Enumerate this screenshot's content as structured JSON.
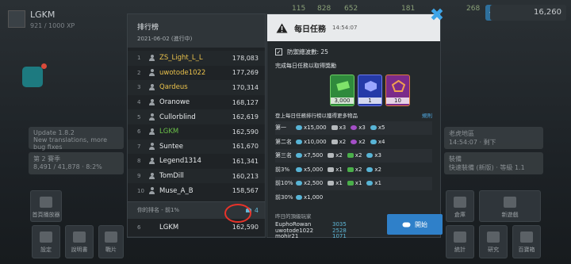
{
  "background": {
    "username": "LGKM",
    "xp": "921 / 1000 XP",
    "resources": [
      "115",
      "828",
      "652",
      "181",
      "268"
    ],
    "cash": "16,260",
    "cards": [
      {
        "title": "Update 1.8.2",
        "subtitle": "New translations, more bug fixes"
      },
      {
        "title": "第 2 賽季",
        "subtitle": "8,491 / 41,878 · 8:2%"
      },
      {
        "title": "老虎地區",
        "subtitle": "14:54:07 · 剩下"
      },
      {
        "title": "裝備",
        "subtitle": "快速裝備 (新版) · 等級 1.1"
      }
    ],
    "buttons": [
      "首頁播放器",
      "設定",
      "說明書",
      "戰片",
      "倉庫",
      "新遊戲",
      "統計",
      "研究",
      "百寶箱"
    ]
  },
  "leaderboard": {
    "title": "排行榜",
    "subtitle": "2021-06-02 (進行中)",
    "rows": [
      {
        "rank": "1",
        "name": "ZS_Light_L_L",
        "score": "178,083",
        "color": "#e9c14b"
      },
      {
        "rank": "2",
        "name": "uwotode1022",
        "score": "177,269",
        "color": "#e9c14b"
      },
      {
        "rank": "3",
        "name": "Qardeus",
        "score": "170,314",
        "color": "#e9c14b"
      },
      {
        "rank": "4",
        "name": "Oranowe",
        "score": "168,127",
        "color": "#e8ebed"
      },
      {
        "rank": "5",
        "name": "Cullorblind",
        "score": "162,619",
        "color": "#e8ebed"
      },
      {
        "rank": "6",
        "name": "LGKM",
        "score": "162,590",
        "color": "#6cc24a"
      },
      {
        "rank": "7",
        "name": "Suntee",
        "score": "161,670",
        "color": "#e8ebed"
      },
      {
        "rank": "8",
        "name": "Legend1314",
        "score": "161,341",
        "color": "#e8ebed"
      },
      {
        "rank": "9",
        "name": "TomDill",
        "score": "160,213",
        "color": "#e8ebed"
      },
      {
        "rank": "10",
        "name": "Muse_A_B",
        "score": "158,567",
        "color": "#e8ebed"
      }
    ],
    "my_rank_label": "你的排名 - 前1%",
    "my_tokens": "4",
    "me": {
      "rank": "6",
      "name": "LGKM",
      "score": "162,590"
    }
  },
  "daily": {
    "title": "每日任務",
    "time": "14:54:07",
    "task": "防禦總波數: 25",
    "complete_label": "完成每日任務以取得獎勵",
    "rewards": [
      {
        "value": "3,000",
        "kind": "green"
      },
      {
        "value": "1",
        "kind": "blue"
      },
      {
        "value": "10",
        "kind": "purple"
      }
    ],
    "rank_label": "登上每日任務排行榜以獲得更多物品",
    "rules": "規則",
    "tiers": [
      {
        "tier": "第一",
        "items": [
          {
            "icon": "tok",
            "v": "x15,000"
          },
          {
            "icon": "gun",
            "v": "x3"
          },
          {
            "icon": "pur",
            "v": "x3"
          },
          {
            "icon": "tok",
            "v": "x5"
          }
        ]
      },
      {
        "tier": "第二名",
        "items": [
          {
            "icon": "tok",
            "v": "x10,000"
          },
          {
            "icon": "gun",
            "v": "x2"
          },
          {
            "icon": "pur",
            "v": "x2"
          },
          {
            "icon": "tok",
            "v": "x4"
          }
        ]
      },
      {
        "tier": "第三名",
        "items": [
          {
            "icon": "tok",
            "v": "x7,500"
          },
          {
            "icon": "gun",
            "v": "x2"
          },
          {
            "icon": "grn",
            "v": "x2"
          },
          {
            "icon": "tok",
            "v": "x3"
          }
        ]
      },
      {
        "tier": "前3%",
        "items": [
          {
            "icon": "tok",
            "v": "x5,000"
          },
          {
            "icon": "gun",
            "v": "x1"
          },
          {
            "icon": "grn",
            "v": "x2"
          },
          {
            "icon": "tok",
            "v": "x2"
          }
        ]
      },
      {
        "tier": "前10%",
        "items": [
          {
            "icon": "tok",
            "v": "x2,500"
          },
          {
            "icon": "gun",
            "v": "x1"
          },
          {
            "icon": "grn",
            "v": "x1"
          },
          {
            "icon": "tok",
            "v": "x1"
          }
        ]
      },
      {
        "tier": "前30%",
        "items": [
          {
            "icon": "tok",
            "v": "x1,000"
          }
        ]
      }
    ],
    "prev_title": "昨日的頂級玩家",
    "prev": [
      {
        "name": "EuphoRowan",
        "value": "3035"
      },
      {
        "name": "uwotode1022",
        "value": "2528"
      },
      {
        "name": "mohir21",
        "value": "1071"
      }
    ],
    "start": "開始"
  }
}
